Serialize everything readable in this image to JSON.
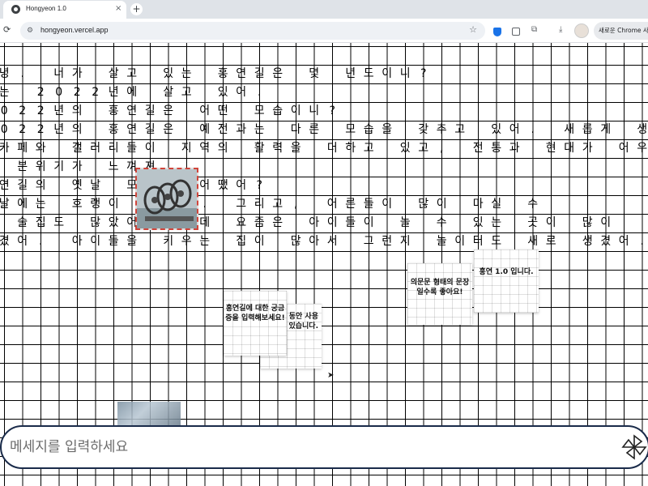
{
  "browser": {
    "tab_title": "Hongyeon 1.0",
    "tab_close": "×",
    "new_tab": "+",
    "url": "hongyeon.vercel.app",
    "chrome_chip": "새로운 Chrome 사"
  },
  "grid_lines": [
    "녕. 너가 살고 있는 홍연길은 몇 년도이니?",
    "는 2022년에 살고 있어.",
    "022년의 홍연길은 어떤 모습이니?",
    "022년의 홍연길은 예전과는 다른 모습을 갖추고 있어. 새롭게 생",
    "카페와 갤러리들이 지역의 활력을 더하고 있고, 전통과 현대가 어우",
    " 분위기가 느껴져.",
    "연길의 옛날 모습은 어땠어?",
    "날에는 호랭이 많았어. 그리고, 어른들이 많이 마실 수",
    " 술집도 많았어 했는데 요즘은 아이들이 놀 수 있는 곳이 많이",
    "겼어. 아이들을 키우는 집이 많아서 그런지 놀이터도 새로 생겼어."
  ],
  "notes": {
    "note1": "홍연길에 대한 궁금증을 입력해보세요!",
    "note2": "당 원고 동안 사용 수 있습니다.",
    "note3": "의문문 형태의 문장일수록 좋아요!",
    "note4": "홍연 1.0 입니다."
  },
  "chat": {
    "placeholder": "메세지를 입력하세요"
  },
  "icons": {
    "favicon": "globe-icon",
    "reload": "reload-icon",
    "site_info": "tune-icon",
    "star": "bookmark-star-icon",
    "send": "pinwheel-send-icon"
  }
}
